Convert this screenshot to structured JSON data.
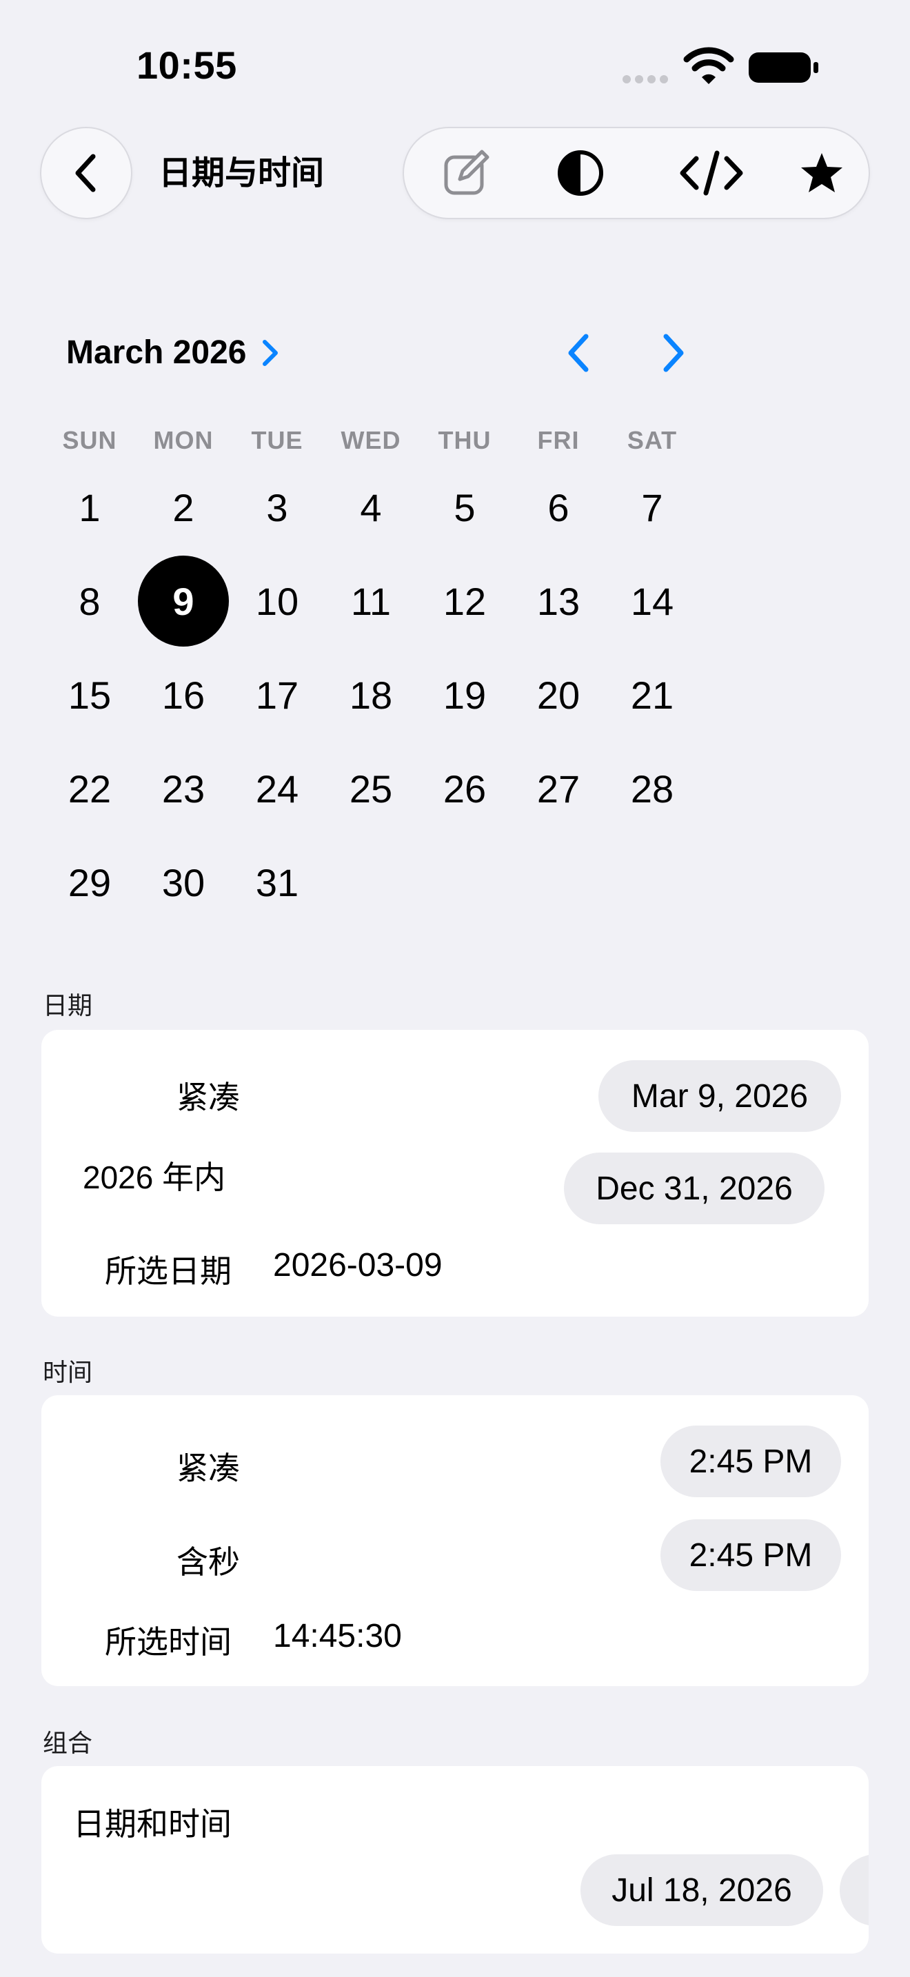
{
  "status_bar": {
    "time": "10:55"
  },
  "nav": {
    "title": "日期与时间",
    "back_icon": "chevron-left-icon",
    "tools": [
      "edit-icon",
      "contrast-icon",
      "code-icon",
      "star-icon"
    ]
  },
  "calendar": {
    "month_label": "March 2026",
    "weekdays": [
      "SUN",
      "MON",
      "TUE",
      "WED",
      "THU",
      "FRI",
      "SAT"
    ],
    "days": [
      "1",
      "2",
      "3",
      "4",
      "5",
      "6",
      "7",
      "8",
      "9",
      "10",
      "11",
      "12",
      "13",
      "14",
      "15",
      "16",
      "17",
      "18",
      "19",
      "20",
      "21",
      "22",
      "23",
      "24",
      "25",
      "26",
      "27",
      "28",
      "29",
      "30",
      "31"
    ],
    "first_weekday_index": 0,
    "selected_day": "9",
    "accent_color": "#0A84FF"
  },
  "date_section": {
    "header": "日期",
    "compact_label": "紧凑",
    "compact_value": "Mar 9, 2026",
    "year_label": "2026 年内",
    "year_value": "Dec 31, 2026",
    "selected_label": "所选日期",
    "selected_value": "2026-03-09"
  },
  "time_section": {
    "header": "时间",
    "compact_label": "紧凑",
    "compact_value": "2:45 PM",
    "seconds_label": "含秒",
    "seconds_value": "2:45 PM",
    "selected_label": "所选时间",
    "selected_value": "14:45:30"
  },
  "combo_section": {
    "header": "组合",
    "label": "日期和时间",
    "date_value": "Jul 18, 2026"
  }
}
